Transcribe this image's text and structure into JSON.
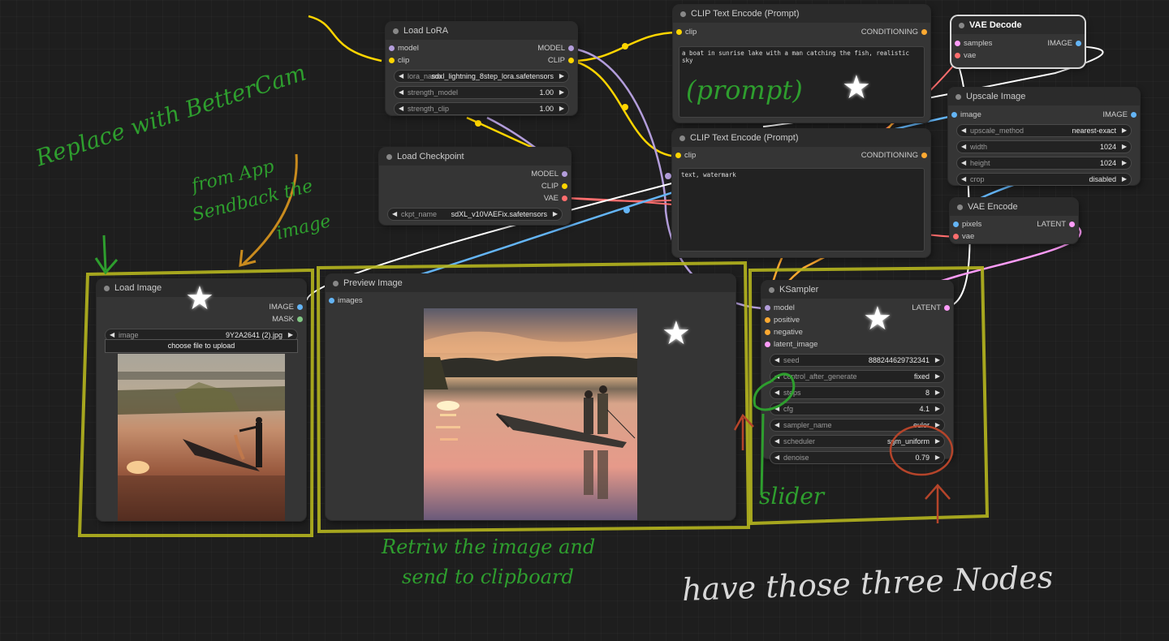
{
  "nodes": {
    "load_lora": {
      "title": "Load LoRA",
      "inputs": [
        "model",
        "clip"
      ],
      "outputs": [
        "MODEL",
        "CLIP"
      ],
      "widgets": [
        {
          "label": "lora_name",
          "value": "sdxl_lightning_8step_lora.safetensors"
        },
        {
          "label": "strength_model",
          "value": "1.00"
        },
        {
          "label": "strength_clip",
          "value": "1.00"
        }
      ]
    },
    "load_checkpoint": {
      "title": "Load Checkpoint",
      "outputs": [
        "MODEL",
        "CLIP",
        "VAE"
      ],
      "widgets": [
        {
          "label": "ckpt_name",
          "value": "sdXL_v10VAEFix.safetensors"
        }
      ]
    },
    "clip_pos": {
      "title": "CLIP Text Encode (Prompt)",
      "input": "clip",
      "output": "CONDITIONING",
      "text": "a boat in sunrise lake with a man catching the fish, realistic sky"
    },
    "clip_neg": {
      "title": "CLIP Text Encode (Prompt)",
      "input": "clip",
      "output": "CONDITIONING",
      "text": "text, watermark"
    },
    "vae_decode": {
      "title": "VAE Decode",
      "inputs": [
        "samples",
        "vae"
      ],
      "output": "IMAGE"
    },
    "upscale": {
      "title": "Upscale Image",
      "input": "image",
      "output": "IMAGE",
      "widgets": [
        {
          "label": "upscale_method",
          "value": "nearest-exact"
        },
        {
          "label": "width",
          "value": "1024"
        },
        {
          "label": "height",
          "value": "1024"
        },
        {
          "label": "crop",
          "value": "disabled"
        }
      ]
    },
    "vae_encode": {
      "title": "VAE Encode",
      "inputs": [
        "pixels",
        "vae"
      ],
      "output": "LATENT"
    },
    "load_image": {
      "title": "Load Image",
      "outputs": [
        "IMAGE",
        "MASK"
      ],
      "widgets": [
        {
          "label": "image",
          "value": "9Y2A2641 (2).jpg"
        }
      ],
      "upload_label": "choose file to upload"
    },
    "preview": {
      "title": "Preview Image",
      "input": "images"
    },
    "ksampler": {
      "title": "KSampler",
      "inputs": [
        "model",
        "positive",
        "negative",
        "latent_image"
      ],
      "output": "LATENT",
      "widgets": [
        {
          "label": "seed",
          "value": "888244629732341"
        },
        {
          "label": "control_after_generate",
          "value": "fixed"
        },
        {
          "label": "steps",
          "value": "8"
        },
        {
          "label": "cfg",
          "value": "4.1"
        },
        {
          "label": "sampler_name",
          "value": "euler"
        },
        {
          "label": "scheduler",
          "value": "sgm_uniform"
        },
        {
          "label": "denoise",
          "value": "0.79"
        }
      ]
    }
  },
  "annotations": {
    "replace": "Replace with BetterCam",
    "from_app": "from App",
    "sendback": "Sendback the",
    "image_word": "image",
    "prompt": "(prompt)",
    "slider": "slider",
    "retrieve_line1": "Retriw the image and",
    "retrieve_line2": "send to clipboard",
    "have_nodes": "have those three Nodes"
  },
  "colors": {
    "model": "#b39ddb",
    "clip": "#ffd500",
    "vae": "#ff6e6e",
    "image": "#64b5f6",
    "latent": "#ff9cf9",
    "conditioning": "#ffa931",
    "mask": "#81c784",
    "annotation_green": "#2e9e2e",
    "frame_yellow": "#b5b51e"
  }
}
